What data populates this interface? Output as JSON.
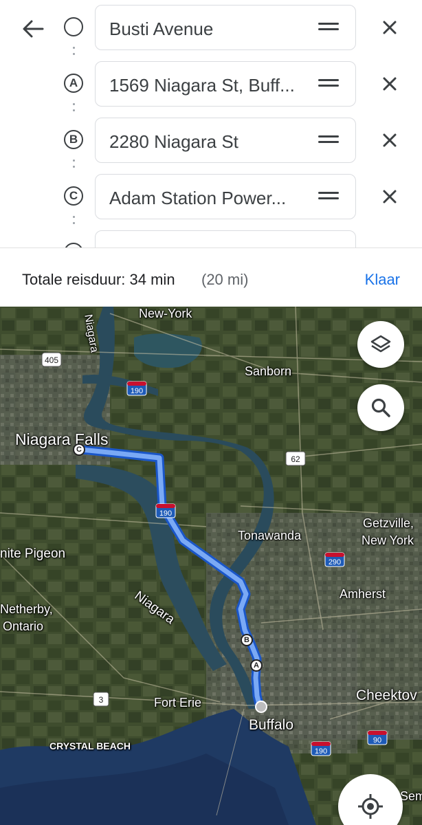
{
  "header": {
    "back_icon": "arrow-left-icon",
    "stops": [
      {
        "marker": "",
        "value": "Busti Avenue"
      },
      {
        "marker": "A",
        "value": "1569 Niagara St, Buff..."
      },
      {
        "marker": "B",
        "value": "2280 Niagara St"
      },
      {
        "marker": "C",
        "value": "Adam Station Power..."
      }
    ]
  },
  "summary": {
    "label": "Totale reisduur: 34 min",
    "distance": "(20 mi)",
    "done": "Klaar"
  },
  "map": {
    "labels": {
      "new_york": "New-York",
      "sanborn": "Sanborn",
      "niagara_falls": "Niagara Falls",
      "tonawanda": "Tonawanda",
      "getzville": "Getzville,",
      "getzville2": "New York",
      "white_pigeon": "nite Pigeon",
      "netherby": "Netherby,",
      "ontario": "Ontario",
      "river1": "Niagara",
      "river2": "Niagara",
      "amherst": "Amherst",
      "fort_erie": "Fort Erie",
      "buffalo": "Buffalo",
      "cheektowaga": "Cheektov",
      "crystal_beach": "CRYSTAL BEACH",
      "sem": "Sem"
    },
    "highways": [
      "405",
      "190",
      "62",
      "190",
      "290",
      "190",
      "90",
      "3"
    ],
    "route_markers": [
      "A",
      "B",
      "C"
    ],
    "colors": {
      "route": "#4285f4",
      "route_outline": "#1a56c8",
      "water": "#203a5c",
      "land": "#3b4a2b"
    }
  }
}
